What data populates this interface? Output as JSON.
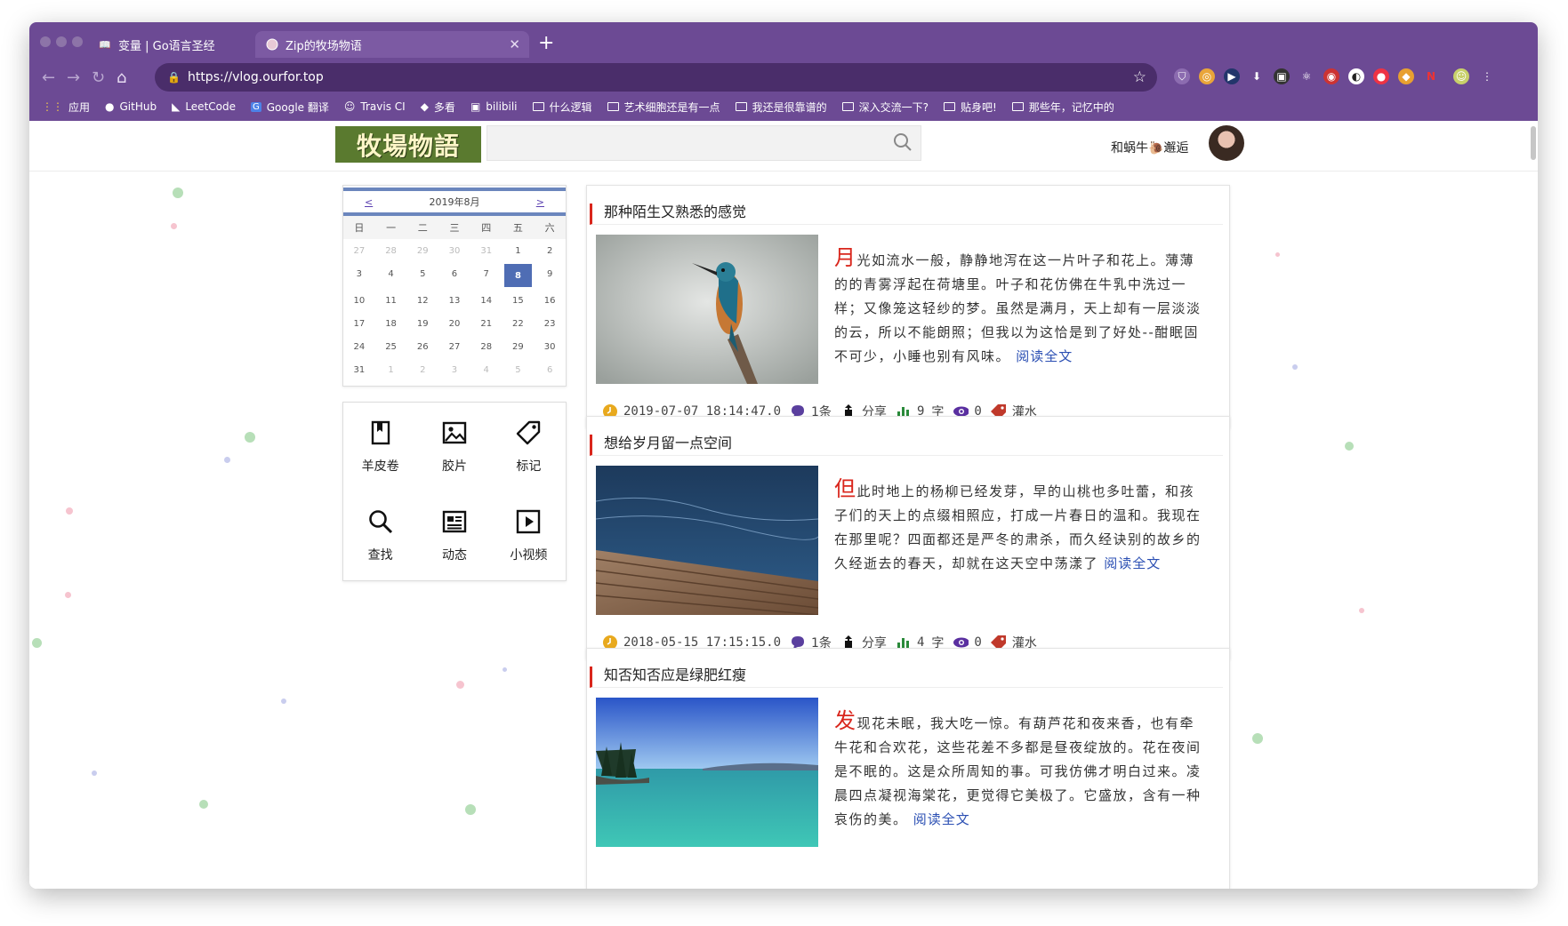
{
  "browser": {
    "tabs": [
      {
        "title": "变量 | Go语言圣经",
        "active": false
      },
      {
        "title": "Zip的牧场物语",
        "active": true
      }
    ],
    "url": "https://vlog.ourfor.top",
    "bookmarks": [
      {
        "label": "应用",
        "icon": "apps-grid-icon"
      },
      {
        "label": "GitHub",
        "icon": "github-icon"
      },
      {
        "label": "LeetCode",
        "icon": "leetcode-icon"
      },
      {
        "label": "Google 翻译",
        "icon": "translate-icon"
      },
      {
        "label": "Travis CI",
        "icon": "travis-icon"
      },
      {
        "label": "多看",
        "icon": "duokan-icon"
      },
      {
        "label": "bilibili",
        "icon": "bilibili-icon"
      },
      {
        "label": "什么逻辑",
        "icon": "folder-icon"
      },
      {
        "label": "艺术细胞还是有一点",
        "icon": "folder-icon"
      },
      {
        "label": "我还是很靠谱的",
        "icon": "folder-icon"
      },
      {
        "label": "深入交流一下?",
        "icon": "folder-icon"
      },
      {
        "label": "贴身吧!",
        "icon": "folder-icon"
      },
      {
        "label": "那些年，记忆中的",
        "icon": "folder-icon"
      }
    ]
  },
  "site": {
    "logo_text": "牧場物語",
    "user_name": "和蜗牛🐌邂逅"
  },
  "calendar": {
    "prev": "<",
    "month_label": "2019年8月",
    "next": ">",
    "weekdays": [
      "日",
      "一",
      "二",
      "三",
      "四",
      "五",
      "六"
    ],
    "days": [
      {
        "d": "27",
        "m": true
      },
      {
        "d": "28",
        "m": true
      },
      {
        "d": "29",
        "m": true
      },
      {
        "d": "30",
        "m": true
      },
      {
        "d": "31",
        "m": true
      },
      {
        "d": "1"
      },
      {
        "d": "2"
      },
      {
        "d": "3"
      },
      {
        "d": "4"
      },
      {
        "d": "5"
      },
      {
        "d": "6"
      },
      {
        "d": "7"
      },
      {
        "d": "8",
        "t": true
      },
      {
        "d": "9"
      },
      {
        "d": "10"
      },
      {
        "d": "11"
      },
      {
        "d": "12"
      },
      {
        "d": "13"
      },
      {
        "d": "14"
      },
      {
        "d": "15"
      },
      {
        "d": "16"
      },
      {
        "d": "17"
      },
      {
        "d": "18"
      },
      {
        "d": "19"
      },
      {
        "d": "20"
      },
      {
        "d": "21"
      },
      {
        "d": "22"
      },
      {
        "d": "23"
      },
      {
        "d": "24"
      },
      {
        "d": "25"
      },
      {
        "d": "26"
      },
      {
        "d": "27"
      },
      {
        "d": "28"
      },
      {
        "d": "29"
      },
      {
        "d": "30"
      },
      {
        "d": "31"
      },
      {
        "d": "1",
        "m": true
      },
      {
        "d": "2",
        "m": true
      },
      {
        "d": "3",
        "m": true
      },
      {
        "d": "4",
        "m": true
      },
      {
        "d": "5",
        "m": true
      },
      {
        "d": "6",
        "m": true
      }
    ]
  },
  "menu": [
    {
      "label": "羊皮卷",
      "icon": "bookmark-icon"
    },
    {
      "label": "胶片",
      "icon": "image-icon"
    },
    {
      "label": "标记",
      "icon": "tag-icon"
    },
    {
      "label": "查找",
      "icon": "search-icon"
    },
    {
      "label": "动态",
      "icon": "news-icon"
    },
    {
      "label": "小视频",
      "icon": "play-icon"
    }
  ],
  "posts": [
    {
      "title": "那种陌生又熟悉的感觉",
      "drop": "月",
      "excerpt": "光如流水一般，静静地泻在这一片叶子和花上。薄薄的的青雾浮起在荷塘里。叶子和花仿佛在牛乳中洗过一样；又像笼这轻纱的梦。虽然是满月，天上却有一层淡淡的云，所以不能朗照；但我以为这恰是到了好处--酣眠固不可少，小睡也别有风味。",
      "more": "阅读全文",
      "date": "2019-07-07 18:14:47.0",
      "comments": "1条",
      "share": "分享",
      "words": "9",
      "words_unit": "字",
      "views": "0",
      "tag": "灌水",
      "image": "kingfisher"
    },
    {
      "title": "想给岁月留一点空间",
      "drop": "但",
      "excerpt": "此时地上的杨柳已经发芽，早的山桃也多吐蕾，和孩子们的天上的点缀相照应，打成一片春日的温和。我现在在那里呢？四面都还是严冬的肃杀，而久经诀别的故乡的久经逝去的春天，却就在这天空中荡漾了",
      "more": "阅读全文",
      "date": "2018-05-15 17:15:15.0",
      "comments": "1条",
      "share": "分享",
      "words": "4",
      "words_unit": "字",
      "views": "0",
      "tag": "灌水",
      "image": "water"
    },
    {
      "title": "知否知否应是绿肥红瘦",
      "drop": "发",
      "excerpt": "现花未眠，我大吃一惊。有葫芦花和夜来香，也有牵牛花和合欢花，这些花差不多都是昼夜绽放的。花在夜间是不眠的。这是众所周知的事。可我仿佛才明白过来。凌晨四点凝视海棠花，更觉得它美极了。它盛放，含有一种哀伤的美。",
      "more": "阅读全文",
      "date": "",
      "comments": "",
      "share": "",
      "words": "",
      "words_unit": "",
      "views": "",
      "tag": "",
      "image": "lake"
    }
  ],
  "colors": {
    "chrome": "#6c4a94",
    "accent_red": "#d9261c",
    "link_blue": "#2b4fb3",
    "calendar_blue": "#4f6db4"
  }
}
